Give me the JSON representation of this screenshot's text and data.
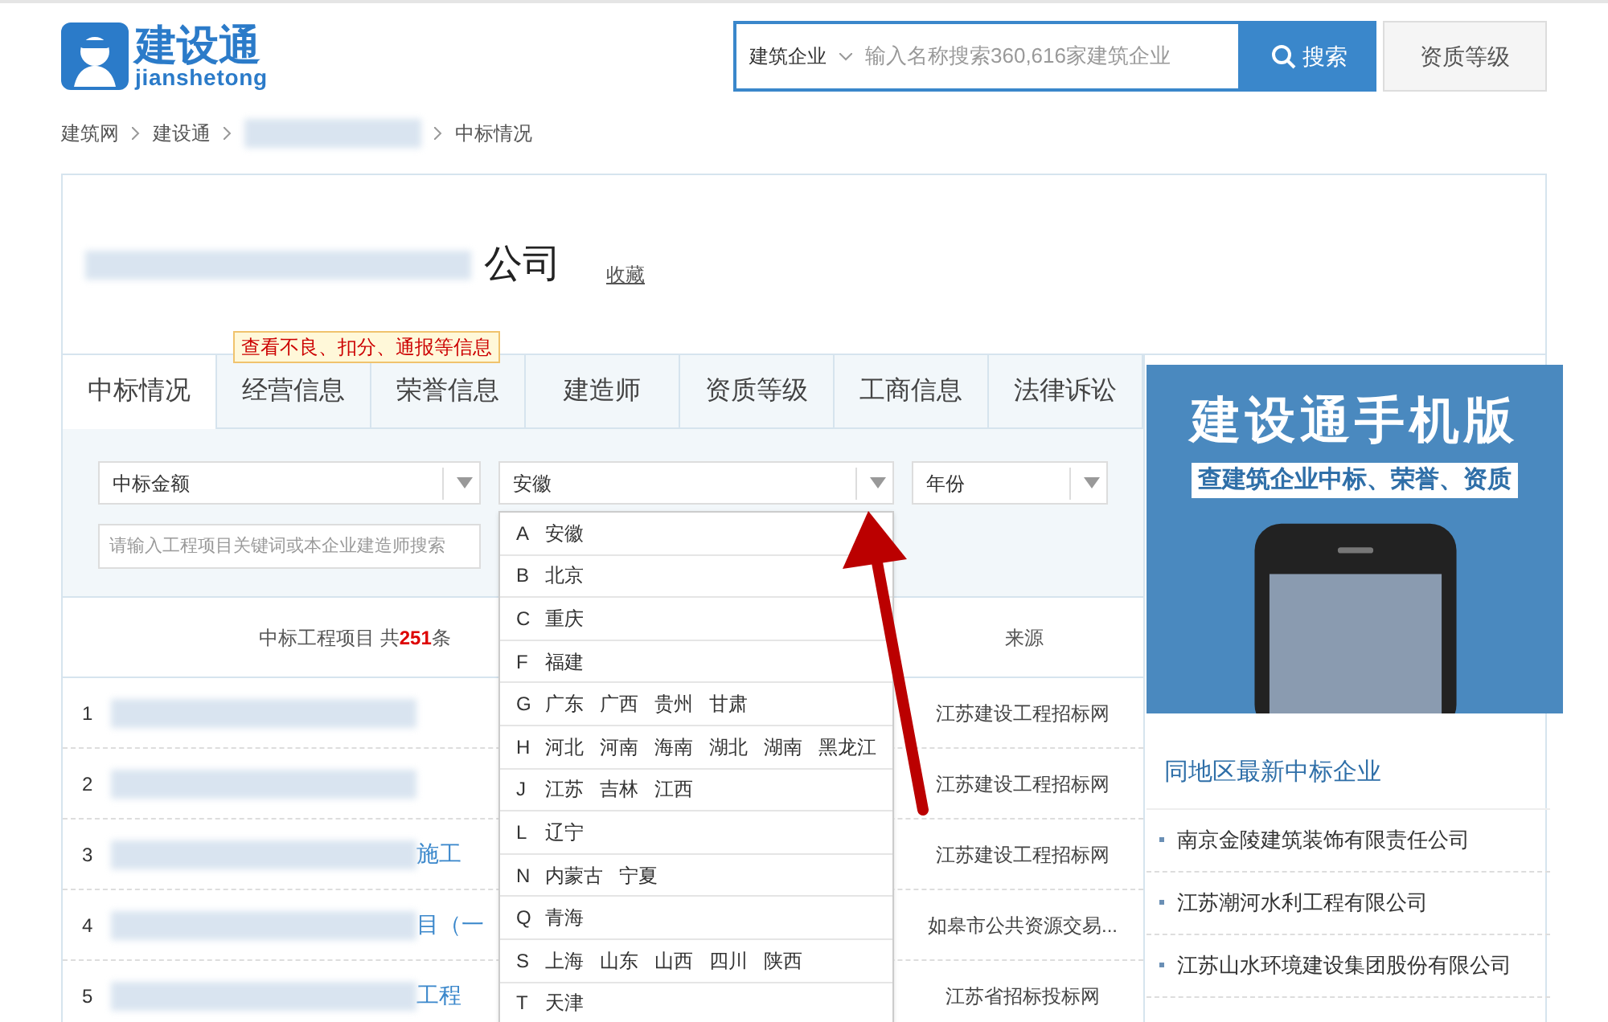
{
  "header": {
    "logo_title": "建设通",
    "logo_subtitle": "jianshetong",
    "search": {
      "category": "建筑企业",
      "placeholder": "输入名称搜索360,616家建筑企业",
      "button": "搜索"
    },
    "qualification_button": "资质等级"
  },
  "breadcrumb": [
    "建筑网",
    "建设通",
    "中标情况"
  ],
  "company": {
    "name_visible": "公司",
    "favorite": "收藏"
  },
  "tooltip": "查看不良、扣分、通报等信息",
  "tabs": [
    {
      "label": "中标情况",
      "selected": true
    },
    {
      "label": "经营信息",
      "selected": false
    },
    {
      "label": "荣誉信息",
      "selected": false
    },
    {
      "label": "建造师",
      "selected": false
    },
    {
      "label": "资质等级",
      "selected": false
    },
    {
      "label": "工商信息",
      "selected": false
    },
    {
      "label": "法律诉讼",
      "selected": false
    }
  ],
  "filters": {
    "amount": "中标金额",
    "province": "安徽",
    "year": "年份",
    "keyword_placeholder": "请输入工程项目关键词或本企业建造师搜索"
  },
  "table": {
    "project_header_prefix": "中标工程项目 共",
    "count": "251",
    "project_header_suffix": "条",
    "source_header": "来源",
    "rows": [
      {
        "index": "1",
        "project_visible": "",
        "source": "江苏建设工程招标网"
      },
      {
        "index": "2",
        "project_visible": "",
        "source": "江苏建设工程招标网"
      },
      {
        "index": "3",
        "project_visible": "施工",
        "source": "江苏建设工程招标网"
      },
      {
        "index": "4",
        "project_visible": "目（一",
        "source": "如皋市公共资源交易..."
      },
      {
        "index": "5",
        "project_visible": "工程",
        "source": "江苏省招标投标网"
      }
    ]
  },
  "dropdown": [
    {
      "letter": "A",
      "provinces": [
        "安徽"
      ]
    },
    {
      "letter": "B",
      "provinces": [
        "北京"
      ]
    },
    {
      "letter": "C",
      "provinces": [
        "重庆"
      ]
    },
    {
      "letter": "F",
      "provinces": [
        "福建"
      ]
    },
    {
      "letter": "G",
      "provinces": [
        "广东",
        "广西",
        "贵州",
        "甘肃"
      ]
    },
    {
      "letter": "H",
      "provinces": [
        "河北",
        "河南",
        "海南",
        "湖北",
        "湖南",
        "黑龙江"
      ]
    },
    {
      "letter": "J",
      "provinces": [
        "江苏",
        "吉林",
        "江西"
      ]
    },
    {
      "letter": "L",
      "provinces": [
        "辽宁"
      ]
    },
    {
      "letter": "N",
      "provinces": [
        "内蒙古",
        "宁夏"
      ]
    },
    {
      "letter": "Q",
      "provinces": [
        "青海"
      ]
    },
    {
      "letter": "S",
      "provinces": [
        "上海",
        "山东",
        "山西",
        "四川",
        "陕西"
      ]
    },
    {
      "letter": "T",
      "provinces": [
        "天津"
      ]
    }
  ],
  "banner": {
    "title": "建设通手机版",
    "subtitle": "查建筑企业中标、荣誉、资质"
  },
  "sidebar": {
    "title": "同地区最新中标企业",
    "companies": [
      "南京金陵建筑装饰有限责任公司",
      "江苏潮河水利工程有限公司",
      "江苏山水环境建设集团股份有限公司"
    ]
  }
}
